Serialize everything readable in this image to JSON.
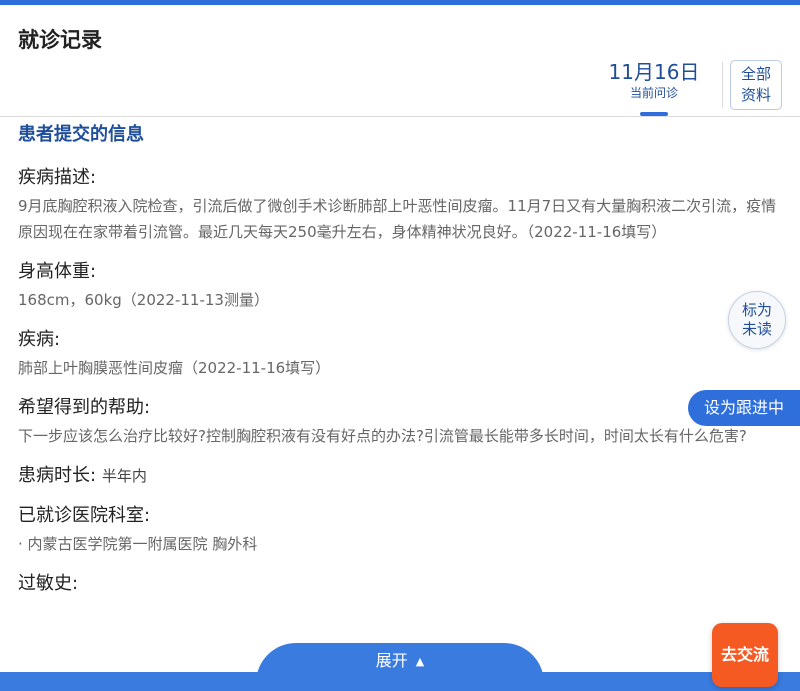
{
  "header": {
    "title": "就诊记录",
    "date_tab": {
      "date": "11月16日",
      "sub": "当前问诊"
    },
    "all_button_line1": "全部",
    "all_button_line2": "资料"
  },
  "section": {
    "title": "患者提交的信息"
  },
  "items": {
    "disease_desc": {
      "label": "疾病描述:",
      "value": "9月底胸腔积液入院检查，引流后做了微创手术诊断肺部上叶恶性间皮瘤。11月7日又有大量胸积液二次引流，疫情原因现在在家带着引流管。最近几天每天250毫升左右，身体精神状况良好。（2022-11-16填写）"
    },
    "height_weight": {
      "label": "身高体重:",
      "value": "168cm，60kg（2022-11-13测量）"
    },
    "disease": {
      "label": "疾病:",
      "value": "肺部上叶胸膜恶性间皮瘤（2022-11-16填写）"
    },
    "help_wanted": {
      "label": "希望得到的帮助:",
      "value": "下一步应该怎么治疗比较好?控制胸腔积液有没有好点的办法?引流管最长能带多长时间，时间太长有什么危害?"
    },
    "duration": {
      "label": "患病时长:",
      "value": "半年内"
    },
    "hospital": {
      "label": "已就诊医院科室:",
      "value": "· 内蒙古医学院第一附属医院 胸外科"
    },
    "allergy": {
      "label": "过敏史:"
    }
  },
  "floating": {
    "mark_unread_line1": "标为",
    "mark_unread_line2": "未读",
    "follow_up": "设为跟进中",
    "chat": "去交流"
  },
  "bottom": {
    "expand": "展开"
  }
}
